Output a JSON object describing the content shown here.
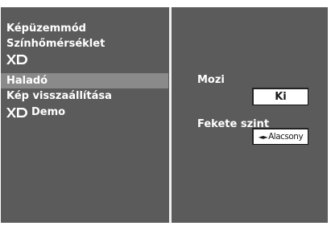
{
  "menu": {
    "items": [
      {
        "label": "Képüzemmód",
        "type": "text",
        "selected": false
      },
      {
        "label": "Színhőmérséklet",
        "type": "text",
        "selected": false
      },
      {
        "label": "",
        "type": "logo",
        "selected": false
      },
      {
        "label": "Haladó",
        "type": "text",
        "selected": true
      },
      {
        "label": "Kép visszaállítása",
        "type": "text",
        "selected": false
      },
      {
        "label": "Demo",
        "type": "logo-text",
        "selected": false
      }
    ]
  },
  "settings": {
    "mozi": {
      "label": "Mozi",
      "value": "Ki"
    },
    "fekete_szint": {
      "label": "Fekete szint",
      "value": "Alacsony",
      "arrows": "◄►"
    }
  },
  "colors": {
    "panel": "#5b5b5b",
    "highlight": "#8a8a8a",
    "text": "#ffffff",
    "value_box": "#ffffff"
  },
  "icons": {
    "xd": "xd-logo-icon",
    "arrows": "left-right-arrows-icon"
  }
}
